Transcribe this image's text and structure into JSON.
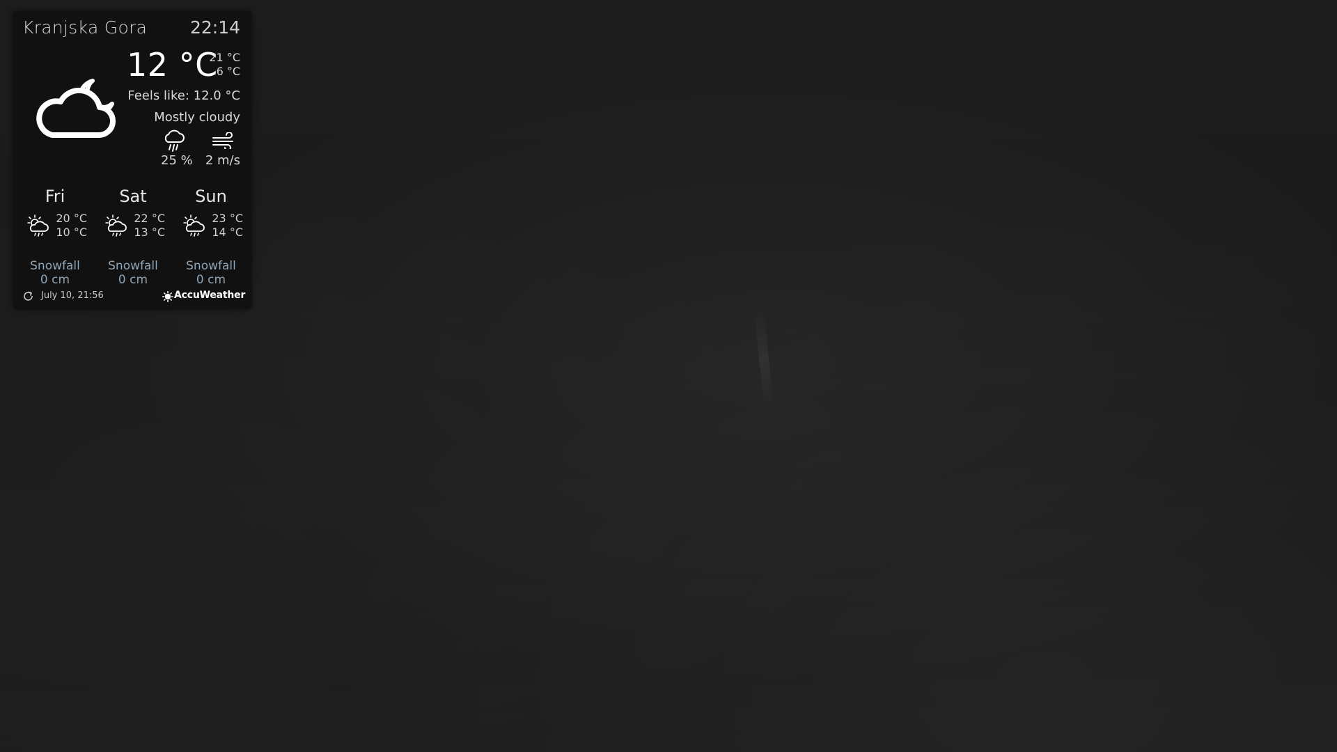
{
  "weather": {
    "location": "Kranjska Gora",
    "time": "22:14",
    "current": {
      "temperature": "12 °C",
      "high": "21 °C",
      "low": "6 °C",
      "feels_like": "Feels like: 12.0 °C",
      "condition": "Mostly cloudy",
      "condition_icon": "cloud-moon-icon",
      "precipitation": "25 %",
      "wind": "2 m/s"
    },
    "forecast": [
      {
        "day": "Fri",
        "high": "20 °C",
        "low": "10 °C",
        "icon": "sun-cloud-rain-icon",
        "snow_label": "Snowfall",
        "snow_value": "0 cm"
      },
      {
        "day": "Sat",
        "high": "22 °C",
        "low": "13 °C",
        "icon": "sun-cloud-rain-icon",
        "snow_label": "Snowfall",
        "snow_value": "0 cm"
      },
      {
        "day": "Sun",
        "high": "23 °C",
        "low": "14 °C",
        "icon": "sun-cloud-rain-icon",
        "snow_label": "Snowfall",
        "snow_value": "0 cm"
      }
    ],
    "footer": {
      "updated": "July 10, 21:56",
      "provider": "AccuWeather"
    }
  },
  "colors": {
    "background": "#1b1b1b",
    "widget": "#111111",
    "snow_text": "#8fa5b8"
  }
}
